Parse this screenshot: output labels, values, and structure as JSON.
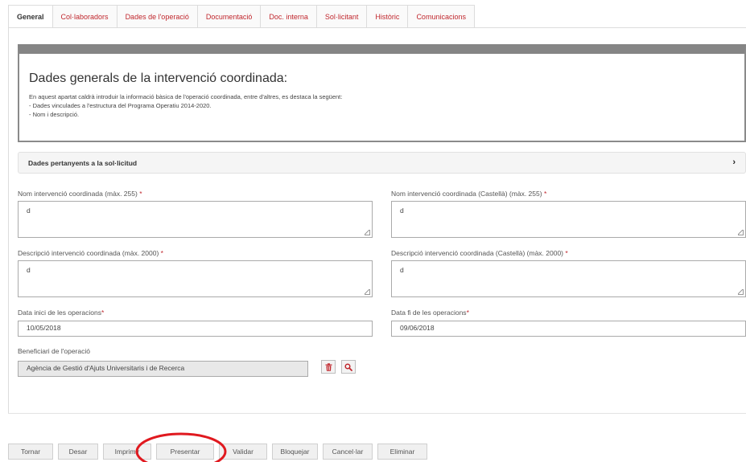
{
  "tabs": [
    {
      "label": "General",
      "active": true
    },
    {
      "label": "Col·laboradors",
      "active": false
    },
    {
      "label": "Dades de l'operació",
      "active": false
    },
    {
      "label": "Documentació",
      "active": false
    },
    {
      "label": "Doc. interna",
      "active": false
    },
    {
      "label": "Sol·licitant",
      "active": false
    },
    {
      "label": "Històric",
      "active": false
    },
    {
      "label": "Comunicacions",
      "active": false
    }
  ],
  "info": {
    "title": "Dades generals de la intervenció coordinada:",
    "intro": "En aquest apartat caldrà introduir la informació bàsica de l'operació coordinada, entre d'altres, es destaca la següent:",
    "bullets": [
      "- Dades vinculades a l'estructura del Programa Operatiu 2014-2020.",
      "- Nom i descripció."
    ]
  },
  "section": {
    "label": "Dades pertanyents a la sol·licitud",
    "chevron": "›"
  },
  "fields": {
    "nom": {
      "label": "Nom intervenció coordinada (màx. 255)",
      "required": "*",
      "value": "d"
    },
    "nom_es": {
      "label": "Nom intervenció coordinada (Castellà) (màx. 255)",
      "required": "*",
      "value": "d"
    },
    "desc": {
      "label": "Descripció intervenció coordinada (màx. 2000)",
      "required": "*",
      "value": "d"
    },
    "desc_es": {
      "label": "Descripció intervenció coordinada (Castellà) (màx. 2000)",
      "required": "*",
      "value": "d"
    },
    "data_inici": {
      "label": "Data inici de les operacions",
      "required": "*",
      "value": "10/05/2018"
    },
    "data_fi": {
      "label": "Data fi de les operacions",
      "required": "*",
      "value": "09/06/2018"
    },
    "beneficiari": {
      "label": "Beneficiari de l'operació",
      "value": "Agència de Gestió d'Ajuts Universitaris i de Recerca"
    }
  },
  "icons": {
    "delete": "trash-icon",
    "search": "search-icon"
  },
  "colors": {
    "accent": "#c0272d",
    "annotation": "#e0191f",
    "header_bar": "#858585"
  },
  "buttons": [
    "Tornar",
    "Desar",
    "Imprimir",
    "Presentar",
    "Validar",
    "Bloquejar",
    "Cancel·lar",
    "Eliminar"
  ]
}
